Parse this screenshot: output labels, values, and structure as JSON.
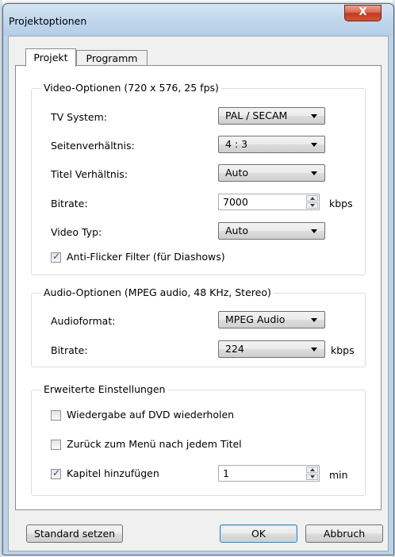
{
  "window": {
    "title": "Projektoptionen",
    "close_glyph": "X"
  },
  "tabs": [
    {
      "label": "Projekt",
      "active": true
    },
    {
      "label": "Programm",
      "active": false
    }
  ],
  "video": {
    "title": "Video-Optionen (720 x 576, 25 fps)",
    "tv_system": {
      "label": "TV System:",
      "value": "PAL / SECAM"
    },
    "aspect": {
      "label": "Seitenverhältnis:",
      "value": "4 : 3"
    },
    "title_ratio": {
      "label": "Titel Verhältnis:",
      "value": "Auto"
    },
    "bitrate": {
      "label": "Bitrate:",
      "value": "7000",
      "unit": "kbps"
    },
    "video_type": {
      "label": "Video Typ:",
      "value": "Auto"
    },
    "antiflicker": {
      "label": "Anti-Flicker Filter (für Diashows)",
      "checked": true
    }
  },
  "audio": {
    "title": "Audio-Optionen (MPEG audio, 48 KHz, Stereo)",
    "format": {
      "label": "Audioformat:",
      "value": "MPEG Audio"
    },
    "bitrate": {
      "label": "Bitrate:",
      "value": "224",
      "unit": "kbps"
    }
  },
  "advanced": {
    "title": "Erweiterte Einstellungen",
    "repeat": {
      "label": "Wiedergabe auf DVD wiederholen",
      "checked": false
    },
    "back_to_menu": {
      "label": "Zurück zum Menü nach jedem Titel",
      "checked": false
    },
    "chapters": {
      "label": "Kapitel hinzufügen",
      "checked": true,
      "value": "1",
      "unit": "min"
    }
  },
  "buttons": {
    "defaults": "Standard setzen",
    "ok": "OK",
    "cancel": "Abbruch"
  },
  "colors": {
    "accent": "#3c7fb1",
    "close": "#c4391f",
    "frame": "#bcd3e8"
  }
}
